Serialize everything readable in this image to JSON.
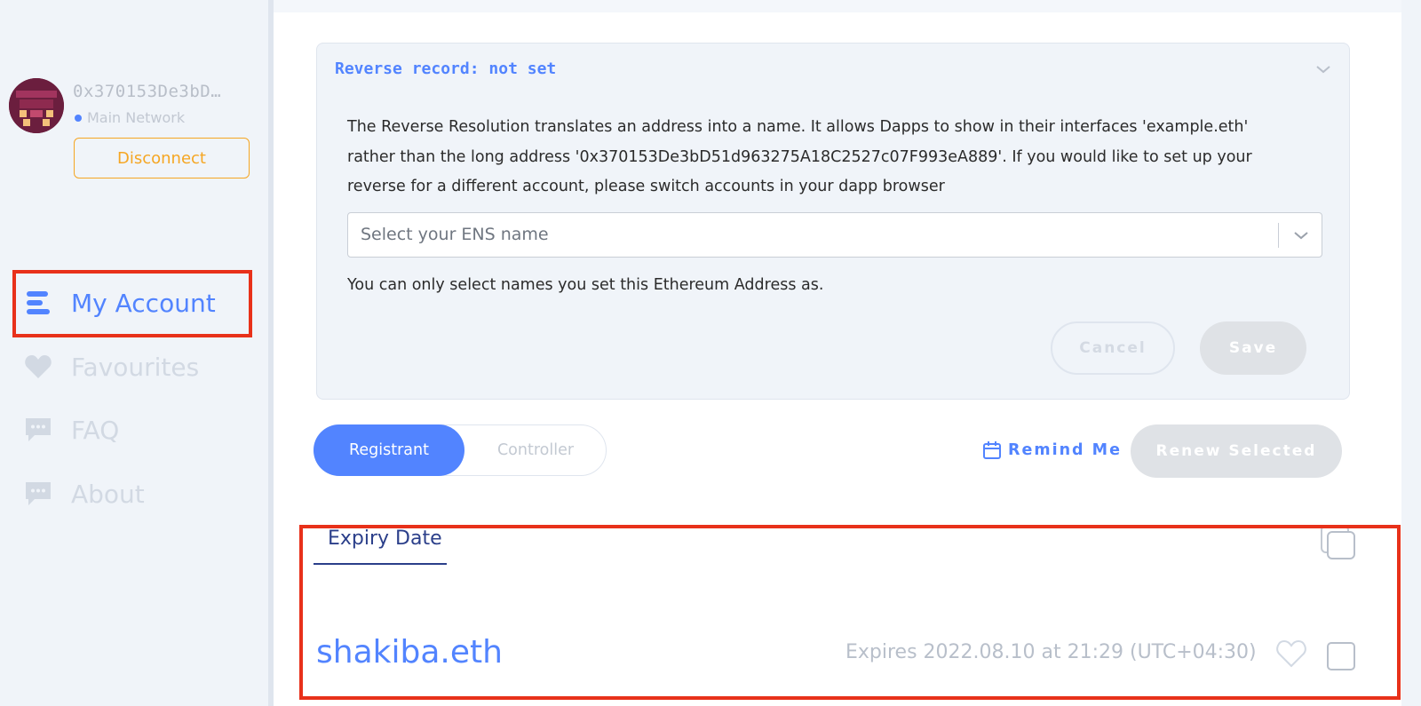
{
  "account": {
    "address": "0x370153De3bD…",
    "network": "Main Network",
    "disconnect_label": "Disconnect"
  },
  "nav": {
    "items": [
      {
        "label": "My Account",
        "icon": "account-icon",
        "active": true
      },
      {
        "label": "Favourites",
        "icon": "heart-icon",
        "active": false
      },
      {
        "label": "FAQ",
        "icon": "chat-bubble-icon",
        "active": false
      },
      {
        "label": "About",
        "icon": "chat-bubble-icon",
        "active": false
      }
    ]
  },
  "reverse_record": {
    "title": "Reverse record: not set",
    "description": "The Reverse Resolution translates an address into a name. It allows Dapps to show in their interfaces 'example.eth' rather than the long address '0x370153De3bD51d963275A18C2527c07F993eA889'. If you would like to set up your reverse for a different account, please switch accounts in your dapp browser",
    "select_placeholder": "Select your ENS name",
    "note": "You can only select names you set this Ethereum Address as.",
    "cancel_label": "Cancel",
    "save_label": "Save"
  },
  "toolbar": {
    "registrant_label": "Registrant",
    "controller_label": "Controller",
    "remind_label": "Remind Me",
    "renew_label": "Renew Selected"
  },
  "list": {
    "sort_tab_label": "Expiry Date",
    "rows": [
      {
        "name": "shakiba.eth",
        "expires": "Expires 2022.08.10 at 21:29 (UTC+04:30)"
      }
    ]
  },
  "colors": {
    "accent": "#5284ff",
    "warning": "#f5a623",
    "highlight": "#e8311a",
    "heading": "#2b3f8a"
  }
}
